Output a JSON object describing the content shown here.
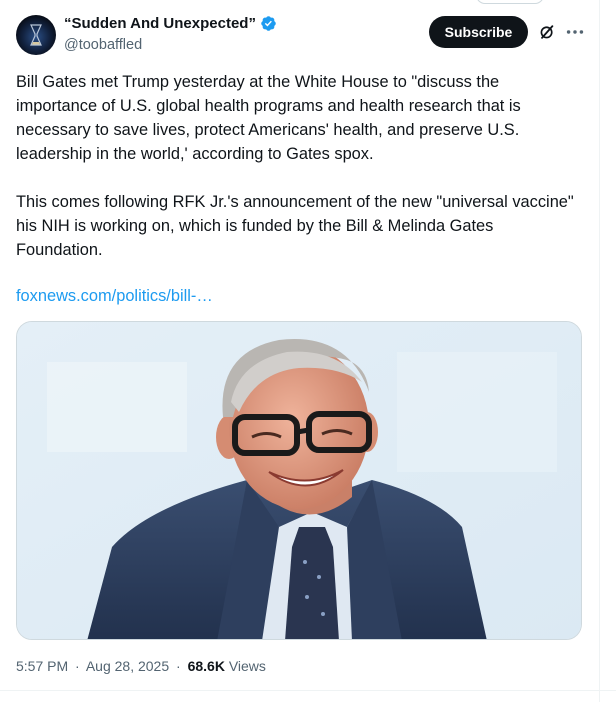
{
  "author": {
    "display_name": "“Sudden And Unexpected”",
    "handle": "@toobaffled",
    "verified": true,
    "avatar_icon": "hourglass-avatar"
  },
  "actions": {
    "subscribe_label": "Subscribe",
    "grok_icon": "grok-icon",
    "more_icon": "more-options-icon"
  },
  "tweet": {
    "paragraphs": [
      "Bill Gates met Trump yesterday at the White House to \"discuss the importance of U.S. global health programs and health research that is necessary to save lives, protect Americans' health, and preserve U.S. leadership in the world,' according to Gates spox.",
      "This comes following RFK Jr.'s announcement of the new \"universal vaccine\" his NIH is working on, which is funded by the Bill & Melinda Gates Foundation."
    ],
    "link_text": "foxnews.com/politics/bill-…"
  },
  "meta": {
    "time": "5:57 PM",
    "date": "Aug 28, 2025",
    "separator": "·",
    "views_count": "68.6K",
    "views_label": "Views"
  },
  "colors": {
    "link": "#1d9bf0",
    "verified": "#1d9bf0",
    "subscribe_bg": "#0f1419",
    "secondary_text": "#536471"
  }
}
